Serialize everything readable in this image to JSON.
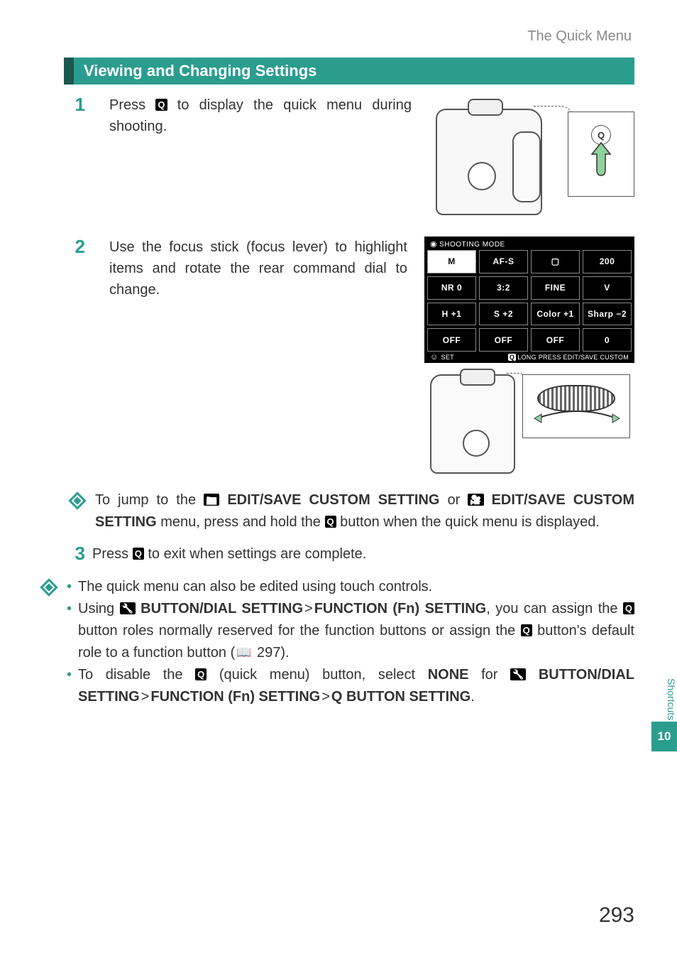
{
  "header": {
    "breadcrumb": "The Quick Menu"
  },
  "section": {
    "title": "Viewing and Changing Settings"
  },
  "steps": {
    "s1": {
      "num": "1",
      "text_a": "Press ",
      "q": "Q",
      "text_b": " to display the quick menu during shooting."
    },
    "s2": {
      "num": "2",
      "text": "Use the focus stick (focus lever) to highlight items and rotate the rear command dial to change."
    },
    "s3": {
      "num": "3",
      "text_a": "Press ",
      "q": "Q",
      "text_b": " to exit when settings are complete."
    }
  },
  "quickmenu": {
    "title": "SHOOTING MODE",
    "cells": [
      "M",
      "AF-S",
      "▢",
      "200",
      "NR 0",
      "3:2",
      "FINE",
      "V",
      "H +1",
      "S +2",
      "Color +1",
      "Sharp −2",
      "OFF",
      "OFF",
      "OFF",
      "0"
    ],
    "footer_set": "SET",
    "footer_long": "LONG PRESS EDIT/SAVE CUSTOM",
    "footer_q": "Q"
  },
  "tip1": {
    "a": "To jump to the ",
    "b": "EDIT/SAVE CUSTOM SETTING",
    "c": " or ",
    "d": "EDIT/SAVE CUSTOM SETTING",
    "e": " menu, press and hold the ",
    "q": "Q",
    "f": " button when the quick menu is displayed."
  },
  "bullets": {
    "b1": "The quick menu can also be edited using touch controls.",
    "b2a": "Using ",
    "b2b": "BUTTON/DIAL SETTING",
    "b2c": "FUNCTION (Fn) SETTING",
    "b2d": ", you can assign the ",
    "b2q1": "Q",
    "b2e": " button roles normally reserved for the function buttons or assign the ",
    "b2q2": "Q",
    "b2f": " button's default role to a function button (",
    "b2page": " 297).",
    "b3a": "To disable the ",
    "b3q": "Q",
    "b3b": " (quick menu) button, select ",
    "b3none": "NONE",
    "b3c": " for ",
    "b3d": "BUTTON/DIAL SETTING",
    "b3e": "FUNCTION (Fn) SETTING",
    "b3f": "Q BUTTON SETTING",
    "b3g": "."
  },
  "side": {
    "label": "Shortcuts",
    "chapter": "10"
  },
  "page": "293"
}
